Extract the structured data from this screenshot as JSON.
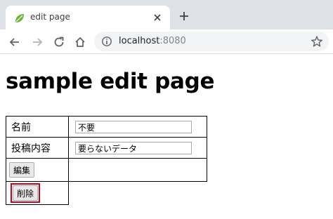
{
  "browser": {
    "tab_title": "edit page",
    "url_host": "localhost",
    "url_port": ":8080"
  },
  "page": {
    "heading": "sample edit page",
    "form": {
      "name_label": "名前",
      "name_value": "不要",
      "content_label": "投稿内容",
      "content_value": "要らないデータ",
      "edit_button": "編集",
      "delete_button": "削除"
    }
  },
  "colors": {
    "highlight": "#d0021b",
    "favicon": "#6db33f"
  }
}
